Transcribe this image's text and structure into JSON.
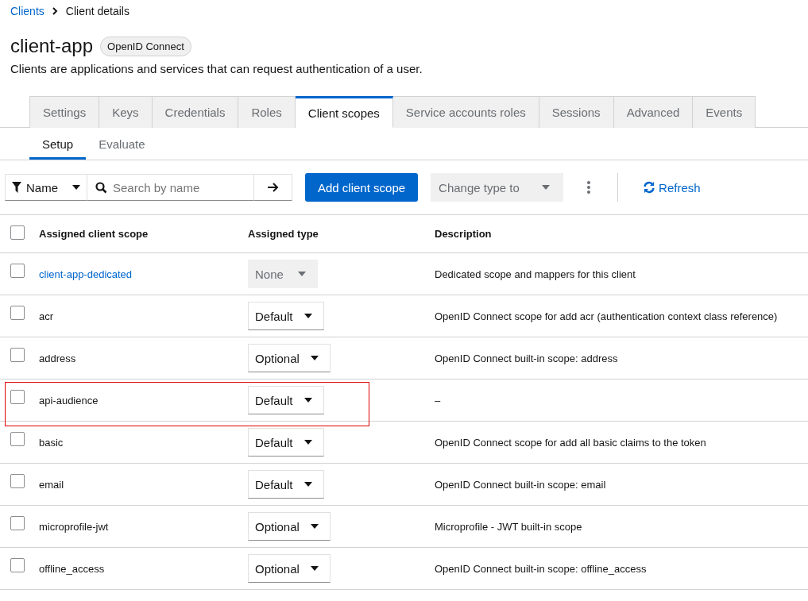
{
  "breadcrumb": [
    {
      "label": "Clients",
      "link": true
    },
    {
      "label": "Client details",
      "link": false
    }
  ],
  "title": "client-app",
  "protocol_badge": "OpenID Connect",
  "subtitle": "Clients are applications and services that can request authentication of a user.",
  "tabs": [
    {
      "label": "Settings",
      "selected": false
    },
    {
      "label": "Keys",
      "selected": false
    },
    {
      "label": "Credentials",
      "selected": false
    },
    {
      "label": "Roles",
      "selected": false
    },
    {
      "label": "Client scopes",
      "selected": true
    },
    {
      "label": "Service accounts roles",
      "selected": false
    },
    {
      "label": "Sessions",
      "selected": false
    },
    {
      "label": "Advanced",
      "selected": false
    },
    {
      "label": "Events",
      "selected": false
    }
  ],
  "subtabs": [
    {
      "label": "Setup",
      "selected": true
    },
    {
      "label": "Evaluate",
      "selected": false
    }
  ],
  "toolbar": {
    "filter": "Name",
    "search": {
      "placeholder": "Search by name"
    },
    "add_button": "Add client scope",
    "change_type": {
      "label": "Change type to",
      "disabled": true
    },
    "refresh": "Refresh"
  },
  "table": {
    "select_all_checked": false,
    "columns": [
      "Assigned client scope",
      "Assigned type",
      "Description"
    ],
    "rows": [
      {
        "checked": false,
        "name": "client-app-dedicated",
        "link": true,
        "type": "None",
        "type_disabled": true,
        "description": "Dedicated scope and mappers for this client",
        "highlighted": false
      },
      {
        "checked": false,
        "name": "acr",
        "link": false,
        "type": "Default",
        "type_disabled": false,
        "description": "OpenID Connect scope for add acr (authentication context class reference)",
        "highlighted": false
      },
      {
        "checked": false,
        "name": "address",
        "link": false,
        "type": "Optional",
        "type_disabled": false,
        "description": "OpenID Connect built-in scope: address",
        "highlighted": false
      },
      {
        "checked": false,
        "name": "api-audience",
        "link": false,
        "type": "Default",
        "type_disabled": false,
        "description": "–",
        "highlighted": true
      },
      {
        "checked": false,
        "name": "basic",
        "link": false,
        "type": "Default",
        "type_disabled": false,
        "description": "OpenID Connect scope for add all basic claims to the token",
        "highlighted": false
      },
      {
        "checked": false,
        "name": "email",
        "link": false,
        "type": "Default",
        "type_disabled": false,
        "description": "OpenID Connect built-in scope: email",
        "highlighted": false
      },
      {
        "checked": false,
        "name": "microprofile-jwt",
        "link": false,
        "type": "Optional",
        "type_disabled": false,
        "description": "Microprofile - JWT built-in scope",
        "highlighted": false
      },
      {
        "checked": false,
        "name": "offline_access",
        "link": false,
        "type": "Optional",
        "type_disabled": false,
        "description": "OpenID Connect built-in scope: offline_access",
        "highlighted": false
      }
    ]
  }
}
